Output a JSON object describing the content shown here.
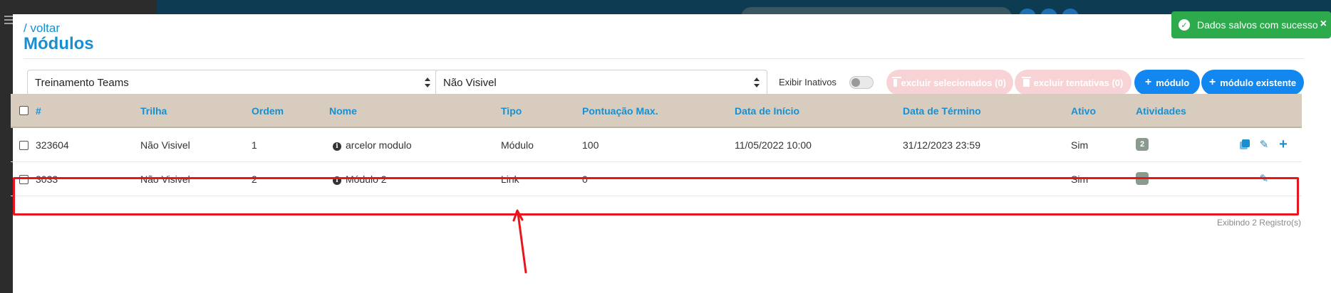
{
  "modal": {
    "back_label": "/ voltar",
    "title": "Módulos"
  },
  "filters": {
    "trilha_selected": "Treinamento Teams",
    "visivel_selected": "Não Visivel",
    "inativos_label": "Exibir Inativos",
    "inativos_on": false
  },
  "toolbar": {
    "excluir_selecionados": "excluir selecionados (0)",
    "excluir_tentativas": "excluir tentativas (0)",
    "modulo": "módulo",
    "modulo_existente": "módulo existente"
  },
  "table": {
    "headers": [
      "#",
      "Trilha",
      "Ordem",
      "Nome",
      "Tipo",
      "Pontuação Max.",
      "Data de Início",
      "Data de Término",
      "Ativo",
      "Atividades"
    ],
    "rows": [
      {
        "id": "323604",
        "trilha": "Não Visivel",
        "ordem": "1",
        "nome": "arcelor modulo",
        "tipo": "Módulo",
        "pontuacao": "100",
        "inicio": "11/05/2022 10:00",
        "termino": "31/12/2023 23:59",
        "ativo": "Sim",
        "atividades": "2"
      },
      {
        "id": "3033",
        "trilha": "Não Visivel",
        "ordem": "2",
        "nome": "Módulo 2",
        "tipo": "Link",
        "pontuacao": "0",
        "inicio": "",
        "termino": "",
        "ativo": "Sim",
        "atividades": "-"
      }
    ],
    "footer": "Exibindo 2 Registro(s)"
  },
  "toast": {
    "message": "Dados salvos com sucesso",
    "color": "#2daa4b"
  },
  "colors": {
    "accent": "#1a8fd0",
    "primary_button": "#1287f0",
    "disabled_button": "#f8d3d6",
    "header_bg": "#d7ccbd",
    "annotation": "#e8161c"
  }
}
